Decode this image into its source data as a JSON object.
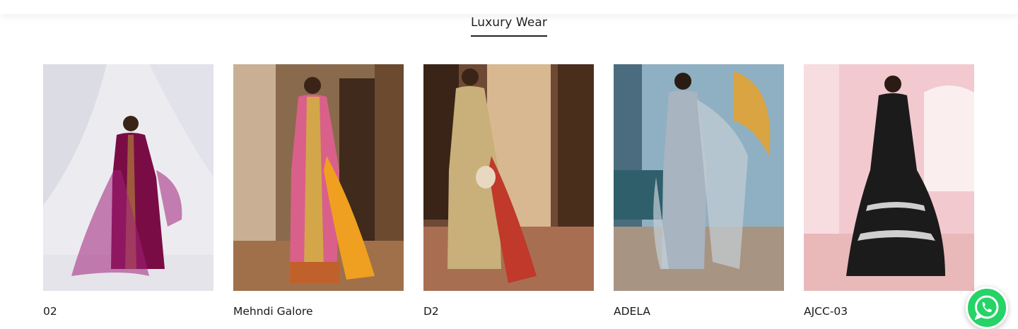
{
  "section": {
    "title": "Luxury Wear"
  },
  "products": [
    {
      "title": "02",
      "image": "model-burgundy-gown",
      "bg": "#e9e9ee",
      "dress": "#7a0c45",
      "accent": "#a0207a"
    },
    {
      "title": "Mehndi Galore",
      "image": "model-pink-orange-dress",
      "bg": "#7a5a40",
      "dress": "#d9608a",
      "accent": "#f0a020"
    },
    {
      "title": "D2",
      "image": "model-gold-dress-red-dupatta",
      "bg": "#6e4a34",
      "dress": "#c9b07a",
      "accent": "#c0392b"
    },
    {
      "title": "ADELA",
      "image": "model-grey-embroidered-dress",
      "bg": "#7fa1b5",
      "dress": "#a8b4bf",
      "accent": "#d9a441"
    },
    {
      "title": "AJCC-03",
      "image": "model-black-lehenga",
      "bg": "#f2c9cf",
      "dress": "#1b1b1b",
      "accent": "#cfcfcf"
    }
  ],
  "whatsapp": {
    "icon": "whatsapp-icon"
  }
}
